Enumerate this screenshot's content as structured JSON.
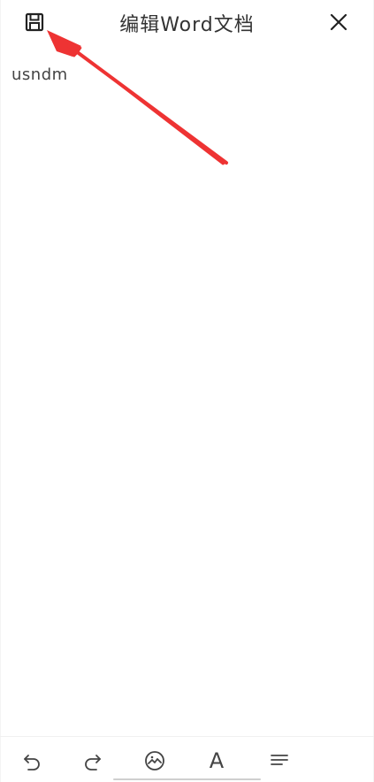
{
  "header": {
    "title": "编辑Word文档",
    "save_icon": "save-icon",
    "close_icon": "close-icon"
  },
  "editor": {
    "content": "usndm"
  },
  "annotation": {
    "arrow_color": "#ee3333"
  },
  "toolbar": {
    "icons": [
      "undo-icon",
      "redo-icon",
      "insert-image-icon",
      "font-icon",
      "align-icon"
    ],
    "font_glyph": "A"
  },
  "colors": {
    "text": "#333333",
    "background": "#ffffff"
  }
}
